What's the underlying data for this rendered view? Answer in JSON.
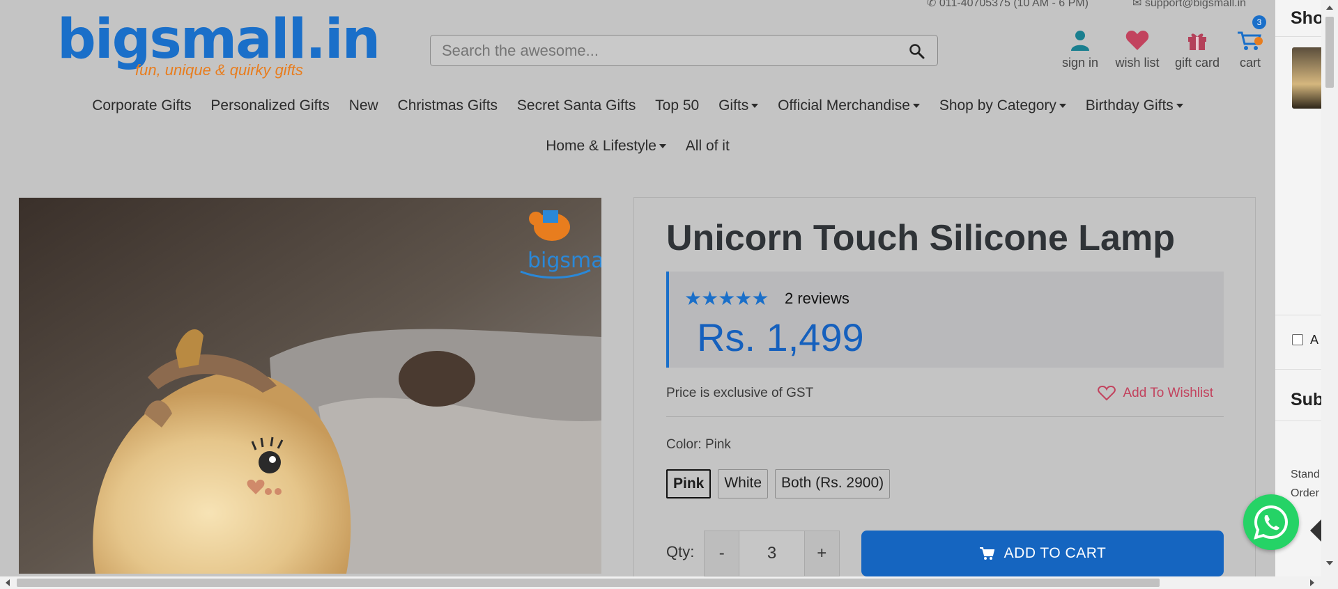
{
  "topbar": {
    "phone": "011-40705375 (10 AM - 6 PM)",
    "email": "support@bigsmall.in"
  },
  "logo": {
    "brand": "bigsmall.in",
    "tagline": "fun, unique & quirky gifts"
  },
  "search": {
    "placeholder": "Search the awesome..."
  },
  "header_icons": {
    "signin": "sign in",
    "wishlist": "wish list",
    "giftcard": "gift card",
    "cart": "cart",
    "cart_count": "3"
  },
  "nav": {
    "row1": [
      "Corporate Gifts",
      "Personalized Gifts",
      "New",
      "Christmas Gifts",
      "Secret Santa Gifts",
      "Top 50",
      "Gifts",
      "Official Merchandise",
      "Shop by Category",
      "Birthday Gifts"
    ],
    "row2": [
      "Home & Lifestyle",
      "All of it"
    ]
  },
  "product": {
    "title": "Unicorn Touch Silicone Lamp",
    "stars": "★★★★★",
    "reviews": "2 reviews",
    "price": "Rs. 1,499",
    "gst_note": "Price is exclusive of GST",
    "wishlist": "Add To Wishlist",
    "color_label": "Color: Pink",
    "colors": [
      "Pink",
      "White",
      "Both (Rs. 2900)"
    ],
    "qty_label": "Qty:",
    "qty_minus": "-",
    "qty_value": "3",
    "qty_plus": "+",
    "add_to_cart": "ADD TO CART",
    "image_watermark": "bigsmall.in"
  },
  "sidebar": {
    "shop_heading": "Sho",
    "checkbox_label": "A",
    "sub_heading": "Sub",
    "line1": "Stand",
    "line2": "Order"
  },
  "colors": {
    "brand_blue": "#1a6fc9",
    "brand_orange": "#e87d1e",
    "wishlist_pink": "#c2435e",
    "cta_blue": "#1565c0",
    "whatsapp_green": "#25d366"
  }
}
